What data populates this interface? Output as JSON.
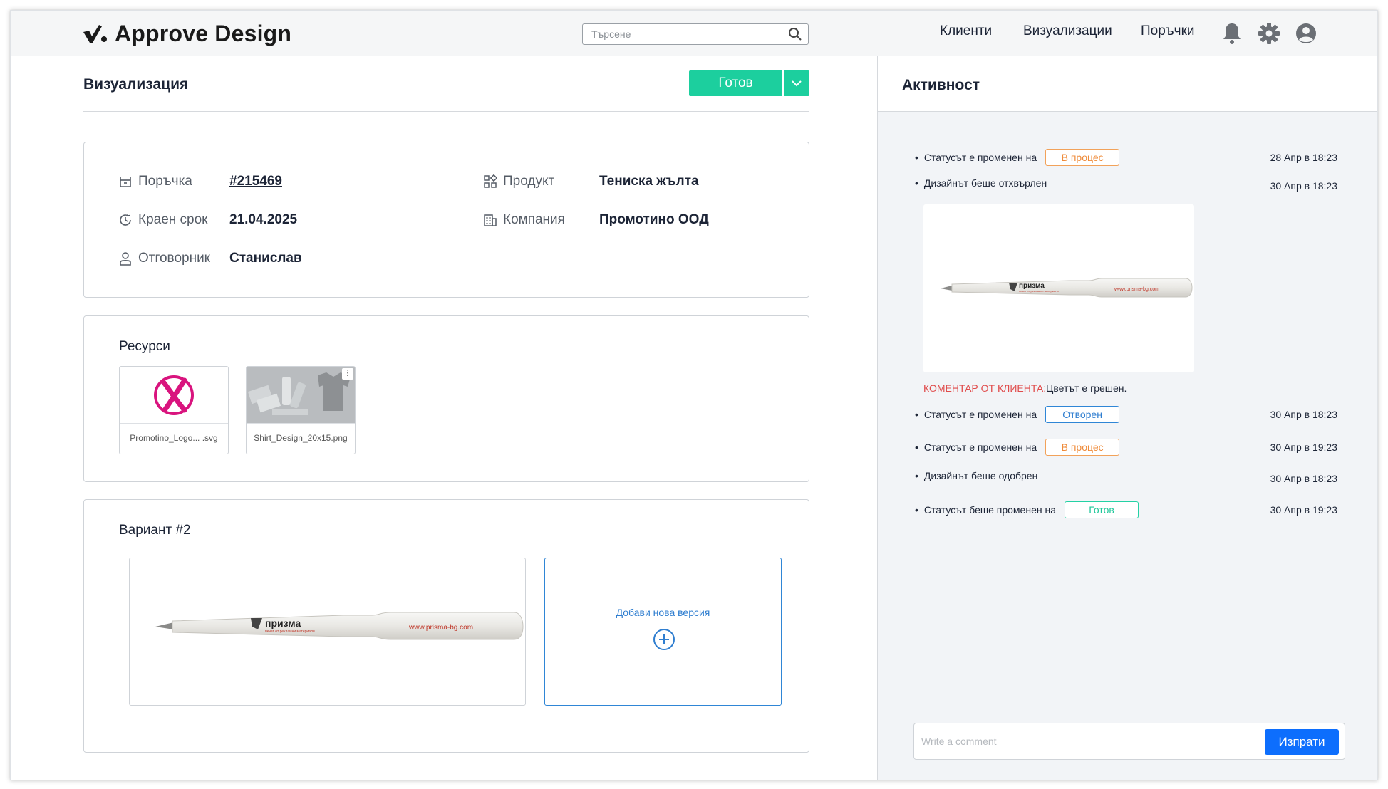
{
  "header": {
    "app_name": "Approve Design",
    "search_placeholder": "Търсене",
    "nav": [
      "Клиенти",
      "Визуализации",
      "Поръчки"
    ]
  },
  "main": {
    "title": "Визуализация",
    "status_button": "Готов",
    "info": {
      "order_label": "Поръчка",
      "order_value": "#215469",
      "deadline_label": "Краен срок",
      "deadline_value": "21.04.2025",
      "responsible_label": "Отговорник",
      "responsible_value": "Станислав",
      "product_label": "Продукт",
      "product_value": "Тениска жълта",
      "company_label": "Компания",
      "company_value": "Промотино ООД"
    },
    "resources": {
      "title": "Ресурси",
      "files": [
        {
          "name": "Promotino_Logo... .svg"
        },
        {
          "name": "Shirt_Design_20x15.png"
        }
      ]
    },
    "variant": {
      "title": "Вариант #2",
      "add_label": "Добави нова версия"
    }
  },
  "pen": {
    "brand": "призма",
    "tagline": "печат от рекламни материали",
    "url": "www.prisma-bg.com"
  },
  "activity": {
    "title": "Активност",
    "items": [
      {
        "text": "Статусът е променен на",
        "badge": "В процес",
        "badge_color": "orange",
        "time": "28 Апр в 18:23"
      },
      {
        "text": "Дизайнът беше отхвърлен",
        "time": "30 Апр в 18:23"
      },
      {
        "text": "Статусът е променен на",
        "badge": "Отворен",
        "badge_color": "blue",
        "time": "30 Апр в 18:23"
      },
      {
        "text": "Статусът е променен на",
        "badge": "В процес",
        "badge_color": "orange",
        "time": "30 Апр в 19:23"
      },
      {
        "text": "Дизайнът беше одобрен",
        "time": "30 Апр в 18:23"
      },
      {
        "text": "Статусът беше променен на",
        "badge": "Готов",
        "badge_color": "green",
        "time": "30 Апр в 19:23"
      }
    ],
    "client_comment_label": "КОМЕНТАР ОТ КЛИЕНТА:",
    "client_comment_text": "Цветът е грешен.",
    "comment_placeholder": "Write a comment",
    "send_label": "Изпрати"
  },
  "colors": {
    "accent_green": "#1ccf9e",
    "accent_blue": "#0d6efd",
    "badge_orange": "#ef8b3a",
    "comment_red": "#e04b4b"
  }
}
